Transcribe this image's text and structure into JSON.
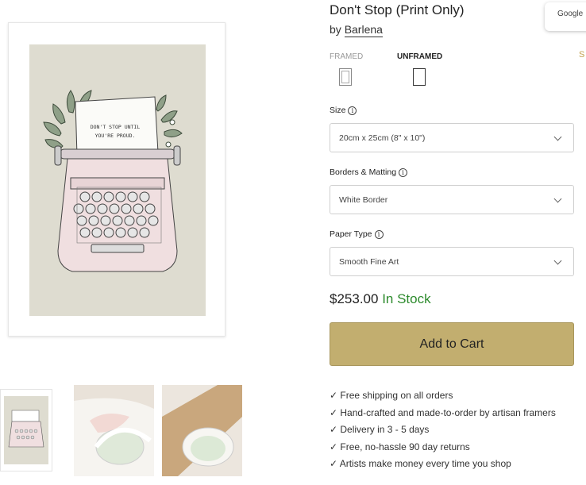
{
  "product": {
    "title": "Don't Stop (Print Only)",
    "by_prefix": "by",
    "artist": "Barlena",
    "art_text_line1": "DON'T STOP UNTIL",
    "art_text_line2": "YOU'RE PROUD."
  },
  "overlay": {
    "google_label": "Google",
    "side_glyph": "S"
  },
  "frame_options": [
    {
      "label": "FRAMED",
      "selected": false
    },
    {
      "label": "UNFRAMED",
      "selected": true
    }
  ],
  "fields": {
    "size": {
      "label": "Size",
      "value": "20cm x 25cm (8\" x 10\")"
    },
    "borders": {
      "label": "Borders & Matting",
      "value": "White Border"
    },
    "paper": {
      "label": "Paper Type",
      "value": "Smooth Fine Art"
    }
  },
  "info_glyph": "i",
  "price": "$253.00",
  "stock_status": "In Stock",
  "add_to_cart_label": "Add to Cart",
  "features": [
    "✓ Free shipping on all orders",
    "✓ Hand-crafted and made-to-order by artisan framers",
    "✓ Delivery in 3 - 5 days",
    "✓ Free, no-hassle 90 day returns",
    "✓ Artists make money every time you shop"
  ],
  "colors": {
    "accent": "#c2ae6f",
    "in_stock": "#2e8b2e",
    "art_background": "#dedcd0"
  }
}
